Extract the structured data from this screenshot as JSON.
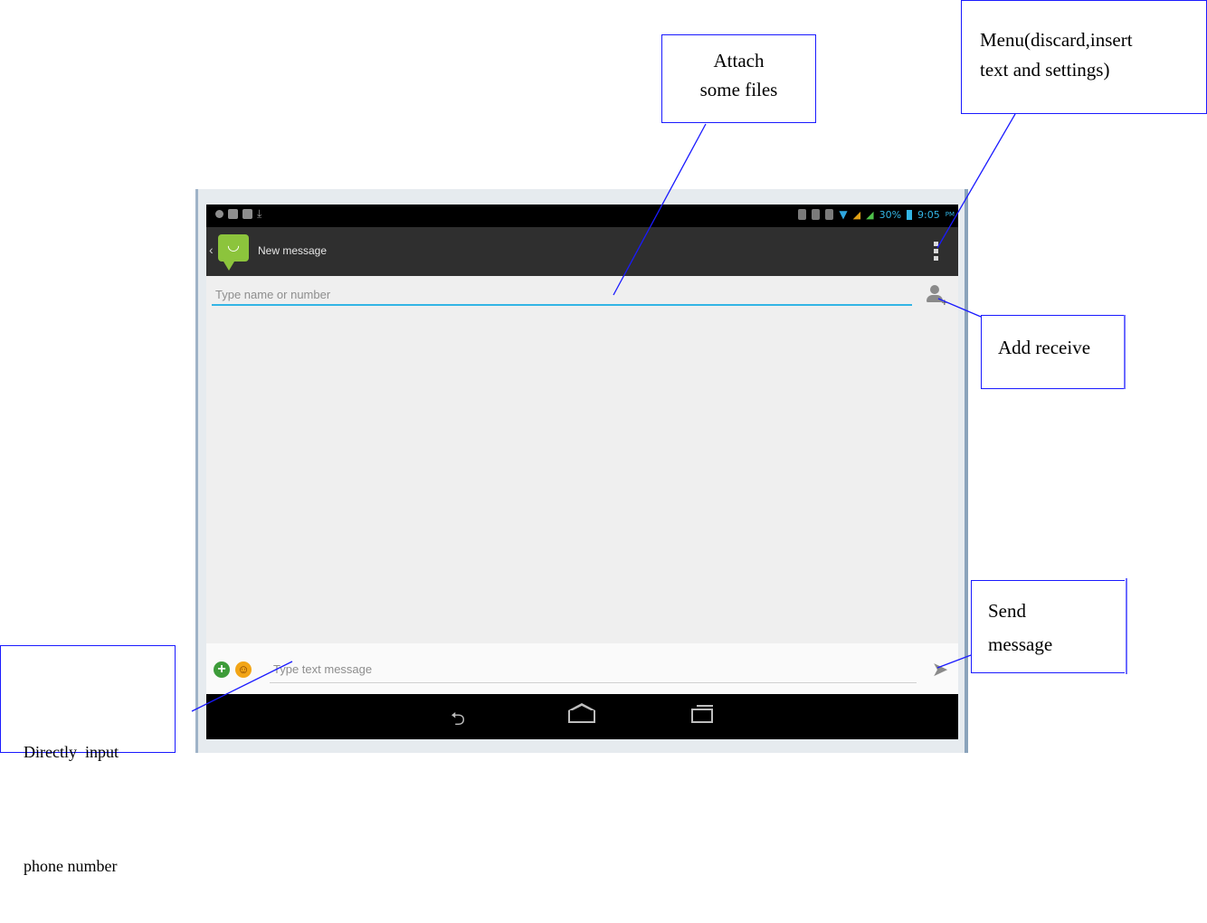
{
  "status_bar": {
    "battery_percent": "30%",
    "time": "9:05",
    "ampm": "PM"
  },
  "action_bar": {
    "title": "New message"
  },
  "recipient": {
    "placeholder": "Type name or number"
  },
  "composer": {
    "placeholder": "Type text message"
  },
  "icons": {
    "overflow": "overflow-menu-icon",
    "add_contact": "add-contact-icon",
    "attach": "add-attachment-icon",
    "emoji": "emoji-icon",
    "send": "send-icon",
    "nav_back": "back-icon",
    "nav_home": "home-icon",
    "nav_recents": "recents-icon"
  },
  "annotations": {
    "attach": [
      "Attach",
      "some files"
    ],
    "menu": [
      "Menu(discard,insert",
      "text and settings)"
    ],
    "add_receiver": "Add receive",
    "send": [
      "Send",
      "message"
    ],
    "direct_input": [
      "Directly  input",
      "phone number"
    ]
  },
  "colors": {
    "accent": "#33b5e5",
    "annotation_line": "#1a1aff",
    "action_bar": "#2f2f2f",
    "app_icon": "#8cc43c"
  }
}
